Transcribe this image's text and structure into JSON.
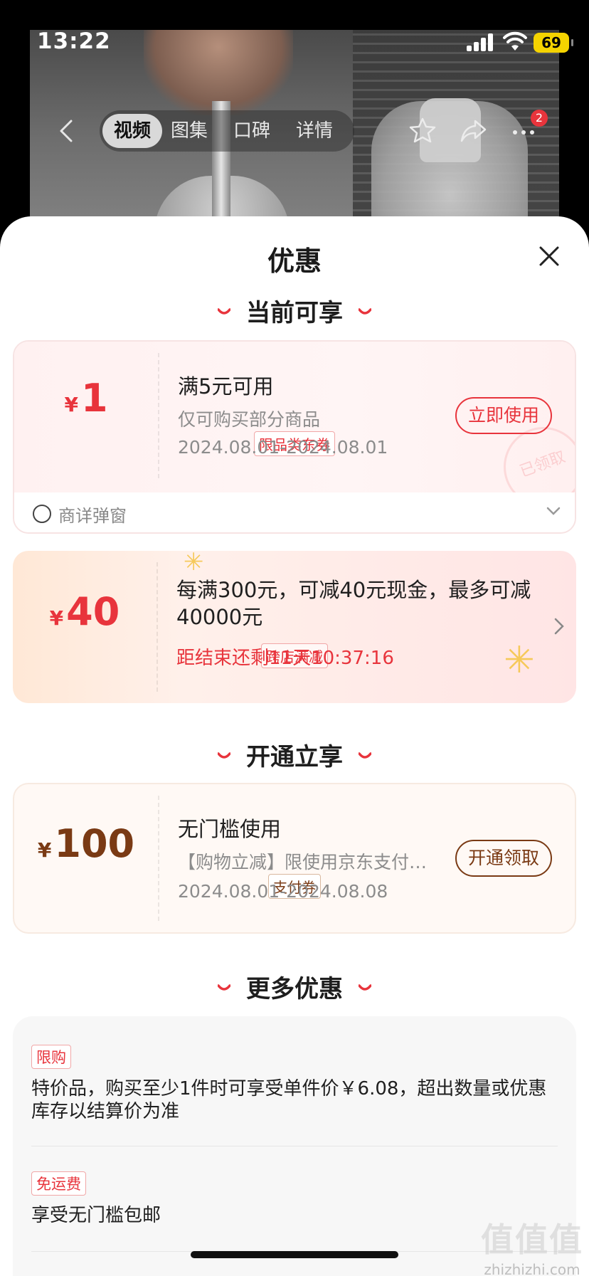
{
  "status": {
    "time": "13:22",
    "battery": "69"
  },
  "nav": {
    "tabs": [
      "视频",
      "图集",
      "口碑",
      "详情"
    ],
    "active_tab": 0,
    "more_badge": "2"
  },
  "sheet": {
    "title": "优惠"
  },
  "sections": {
    "current": "当前可享",
    "activate": "开通立享",
    "more": "更多优惠"
  },
  "coupon1": {
    "currency": "¥",
    "amount": "1",
    "tag": "限品类东券",
    "title": "满5元可用",
    "desc": "仅可购买部分商品",
    "validity": "2024.08.01-2024.08.01",
    "action": "立即使用",
    "stamp": "已领取",
    "footer": "商详弹窗"
  },
  "coupon2": {
    "currency": "¥",
    "amount": "40",
    "tag": "跨店满减",
    "title": "每满300元，可减40元现金，最多可减40000元",
    "countdown": "距结束还剩11天10:37:16"
  },
  "coupon3": {
    "currency": "¥",
    "amount": "100",
    "tag": "支付券",
    "title": "无门槛使用",
    "desc": "【购物立减】限使用京东支付…",
    "validity": "2024.08.01-2024.08.08",
    "action": "开通领取"
  },
  "more_items": [
    {
      "tag": "限购",
      "text": "特价品，购买至少1件时可享受单件价￥6.08，超出数量或优惠库存以结算价为准"
    },
    {
      "tag": "免运费",
      "text": "享受无门槛包邮"
    }
  ],
  "watermark": {
    "text": "值值值",
    "site": "zhizhizhi.com"
  },
  "colors": {
    "accent": "#e8343c",
    "brown": "#7a3a14"
  }
}
